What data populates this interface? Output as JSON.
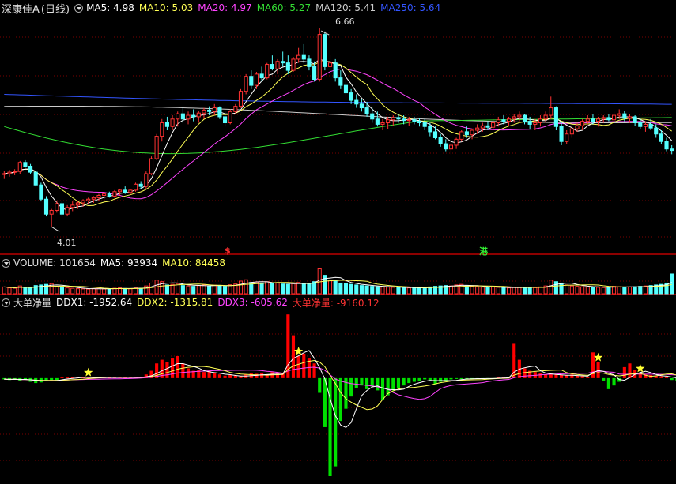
{
  "colors": {
    "up": "#ff3232",
    "down": "#54ffff",
    "ddx_pos": "#ff0000",
    "ddx_neg": "#00e000",
    "ma5": "#ffffff",
    "ma10": "#ffff55",
    "ma20": "#ff44ff",
    "ma60": "#33dd33",
    "ma120": "#cccccc",
    "ma250": "#3355ff",
    "grid": "#7a0000",
    "separator": "#bb0000"
  },
  "price_panel": {
    "title": "深康佳A",
    "period": "(日线)",
    "icon": "chevron-down-icon",
    "mas": [
      {
        "label": "MA5: 4.98",
        "color": "#ffffff"
      },
      {
        "label": "MA10: 5.03",
        "color": "#ffff55"
      },
      {
        "label": "MA20: 4.97",
        "color": "#ff44ff"
      },
      {
        "label": "MA60: 5.27",
        "color": "#33dd33"
      },
      {
        "label": "MA120: 5.41",
        "color": "#cccccc"
      },
      {
        "label": "MA250: 5.64",
        "color": "#3355ff"
      }
    ],
    "high_label": "6.66",
    "low_label": "4.01",
    "marker_s": "$",
    "marker_gang": "港"
  },
  "volume_panel": {
    "title": "VOLUME: 101654",
    "ma5": "MA5: 93934",
    "ma10": "MA10: 84458"
  },
  "ddx_panel": {
    "title": "大单净量",
    "ddx1": "DDX1: -1952.64",
    "ddx2": "DDX2: -1315.81",
    "ddx3": "DDX3: -605.62",
    "net": "大单净量: -9160.12"
  },
  "chart_data": {
    "type": "candlestick",
    "count": 132,
    "y_range_price": [
      3.75,
      6.85
    ],
    "ohlc": [
      [
        4.72,
        4.76,
        4.65,
        4.72
      ],
      [
        4.72,
        4.77,
        4.68,
        4.74
      ],
      [
        4.74,
        4.78,
        4.7,
        4.75
      ],
      [
        4.75,
        4.89,
        4.72,
        4.87
      ],
      [
        4.87,
        4.9,
        4.8,
        4.82
      ],
      [
        4.82,
        4.85,
        4.72,
        4.74
      ],
      [
        4.74,
        4.76,
        4.55,
        4.57
      ],
      [
        4.57,
        4.6,
        4.35,
        4.38
      ],
      [
        4.38,
        4.42,
        4.15,
        4.18
      ],
      [
        4.18,
        4.25,
        4.01,
        4.23
      ],
      [
        4.23,
        4.35,
        4.2,
        4.32
      ],
      [
        4.32,
        4.35,
        4.15,
        4.18
      ],
      [
        4.18,
        4.3,
        4.15,
        4.27
      ],
      [
        4.27,
        4.35,
        4.22,
        4.3
      ],
      [
        4.3,
        4.36,
        4.25,
        4.33
      ],
      [
        4.33,
        4.38,
        4.28,
        4.36
      ],
      [
        4.36,
        4.4,
        4.32,
        4.38
      ],
      [
        4.38,
        4.42,
        4.33,
        4.4
      ],
      [
        4.4,
        4.45,
        4.35,
        4.43
      ],
      [
        4.43,
        4.47,
        4.38,
        4.45
      ],
      [
        4.45,
        4.48,
        4.4,
        4.42
      ],
      [
        4.42,
        4.5,
        4.4,
        4.48
      ],
      [
        4.48,
        4.52,
        4.43,
        4.5
      ],
      [
        4.5,
        4.55,
        4.45,
        4.47
      ],
      [
        4.47,
        4.52,
        4.44,
        4.5
      ],
      [
        4.5,
        4.6,
        4.48,
        4.58
      ],
      [
        4.58,
        4.62,
        4.52,
        4.55
      ],
      [
        4.55,
        4.75,
        4.52,
        4.72
      ],
      [
        4.72,
        4.95,
        4.7,
        4.92
      ],
      [
        4.92,
        5.25,
        4.9,
        5.22
      ],
      [
        5.22,
        5.45,
        5.15,
        5.4
      ],
      [
        5.4,
        5.48,
        5.3,
        5.35
      ],
      [
        5.35,
        5.5,
        5.3,
        5.45
      ],
      [
        5.45,
        5.55,
        5.35,
        5.52
      ],
      [
        5.52,
        5.6,
        5.4,
        5.45
      ],
      [
        5.45,
        5.55,
        5.38,
        5.5
      ],
      [
        5.5,
        5.58,
        5.42,
        5.48
      ],
      [
        5.48,
        5.56,
        5.4,
        5.53
      ],
      [
        5.53,
        5.6,
        5.45,
        5.57
      ],
      [
        5.57,
        5.62,
        5.5,
        5.55
      ],
      [
        5.55,
        5.65,
        5.5,
        5.6
      ],
      [
        5.6,
        5.62,
        5.45,
        5.48
      ],
      [
        5.48,
        5.55,
        5.35,
        5.4
      ],
      [
        5.4,
        5.58,
        5.38,
        5.55
      ],
      [
        5.55,
        5.65,
        5.52,
        5.62
      ],
      [
        5.62,
        5.85,
        5.6,
        5.82
      ],
      [
        5.82,
        6.05,
        5.78,
        6.02
      ],
      [
        6.02,
        6.1,
        5.85,
        5.9
      ],
      [
        5.9,
        6.08,
        5.85,
        6.05
      ],
      [
        6.05,
        6.15,
        5.95,
        6.0
      ],
      [
        6.0,
        6.2,
        5.98,
        6.18
      ],
      [
        6.18,
        6.3,
        6.1,
        6.12
      ],
      [
        6.12,
        6.25,
        6.05,
        6.22
      ],
      [
        6.22,
        6.35,
        6.15,
        6.2
      ],
      [
        6.2,
        6.3,
        6.05,
        6.1
      ],
      [
        6.1,
        6.28,
        6.08,
        6.25
      ],
      [
        6.25,
        6.4,
        6.2,
        6.3
      ],
      [
        6.3,
        6.45,
        6.2,
        6.25
      ],
      [
        6.25,
        6.3,
        6.1,
        6.15
      ],
      [
        6.15,
        6.22,
        5.95,
        5.98
      ],
      [
        5.98,
        6.66,
        5.95,
        6.58
      ],
      [
        6.58,
        6.62,
        6.1,
        6.15
      ],
      [
        6.15,
        6.3,
        6.08,
        6.2
      ],
      [
        6.2,
        6.25,
        5.95,
        6.0
      ],
      [
        6.0,
        6.1,
        5.85,
        5.9
      ],
      [
        5.9,
        5.95,
        5.75,
        5.8
      ],
      [
        5.8,
        5.85,
        5.65,
        5.7
      ],
      [
        5.7,
        5.78,
        5.6,
        5.65
      ],
      [
        5.65,
        5.72,
        5.55,
        5.6
      ],
      [
        5.6,
        5.68,
        5.48,
        5.52
      ],
      [
        5.52,
        5.6,
        5.4,
        5.45
      ],
      [
        5.45,
        5.55,
        5.35,
        5.38
      ],
      [
        5.38,
        5.45,
        5.3,
        5.4
      ],
      [
        5.4,
        5.48,
        5.32,
        5.44
      ],
      [
        5.44,
        5.5,
        5.36,
        5.47
      ],
      [
        5.47,
        5.52,
        5.4,
        5.45
      ],
      [
        5.45,
        5.5,
        5.38,
        5.43
      ],
      [
        5.43,
        5.48,
        5.36,
        5.44
      ],
      [
        5.44,
        5.48,
        5.38,
        5.42
      ],
      [
        5.42,
        5.46,
        5.35,
        5.4
      ],
      [
        5.4,
        5.45,
        5.3,
        5.35
      ],
      [
        5.35,
        5.4,
        5.22,
        5.28
      ],
      [
        5.28,
        5.35,
        5.18,
        5.2
      ],
      [
        5.2,
        5.25,
        5.08,
        5.12
      ],
      [
        5.12,
        5.18,
        5.02,
        5.05
      ],
      [
        5.05,
        5.12,
        4.98,
        5.1
      ],
      [
        5.1,
        5.2,
        5.05,
        5.18
      ],
      [
        5.18,
        5.3,
        5.15,
        5.28
      ],
      [
        5.28,
        5.35,
        5.2,
        5.24
      ],
      [
        5.24,
        5.32,
        5.18,
        5.3
      ],
      [
        5.3,
        5.38,
        5.25,
        5.33
      ],
      [
        5.33,
        5.4,
        5.28,
        5.36
      ],
      [
        5.36,
        5.42,
        5.3,
        5.34
      ],
      [
        5.34,
        5.45,
        5.3,
        5.4
      ],
      [
        5.4,
        5.48,
        5.35,
        5.44
      ],
      [
        5.44,
        5.5,
        5.38,
        5.42
      ],
      [
        5.42,
        5.48,
        5.36,
        5.45
      ],
      [
        5.45,
        5.52,
        5.4,
        5.48
      ],
      [
        5.48,
        5.55,
        5.42,
        5.5
      ],
      [
        5.5,
        5.52,
        5.38,
        5.42
      ],
      [
        5.42,
        5.48,
        5.32,
        5.38
      ],
      [
        5.38,
        5.45,
        5.3,
        5.4
      ],
      [
        5.4,
        5.5,
        5.35,
        5.45
      ],
      [
        5.45,
        5.55,
        5.4,
        5.5
      ],
      [
        5.5,
        5.75,
        5.45,
        5.6
      ],
      [
        5.6,
        5.62,
        5.3,
        5.35
      ],
      [
        5.35,
        5.42,
        5.1,
        5.15
      ],
      [
        5.15,
        5.3,
        5.12,
        5.25
      ],
      [
        5.25,
        5.35,
        5.2,
        5.32
      ],
      [
        5.32,
        5.4,
        5.28,
        5.36
      ],
      [
        5.36,
        5.45,
        5.3,
        5.42
      ],
      [
        5.42,
        5.5,
        5.38,
        5.45
      ],
      [
        5.45,
        5.52,
        5.38,
        5.42
      ],
      [
        5.42,
        5.48,
        5.35,
        5.45
      ],
      [
        5.45,
        5.5,
        5.4,
        5.47
      ],
      [
        5.47,
        5.52,
        5.42,
        5.44
      ],
      [
        5.44,
        5.55,
        5.4,
        5.5
      ],
      [
        5.5,
        5.58,
        5.45,
        5.52
      ],
      [
        5.52,
        5.56,
        5.42,
        5.46
      ],
      [
        5.46,
        5.52,
        5.4,
        5.48
      ],
      [
        5.48,
        5.5,
        5.36,
        5.4
      ],
      [
        5.4,
        5.46,
        5.32,
        5.35
      ],
      [
        5.35,
        5.42,
        5.28,
        5.38
      ],
      [
        5.38,
        5.45,
        5.3,
        5.33
      ],
      [
        5.33,
        5.38,
        5.2,
        5.25
      ],
      [
        5.25,
        5.3,
        5.12,
        5.15
      ],
      [
        5.15,
        5.2,
        5.02,
        5.05
      ],
      [
        5.05,
        5.1,
        4.98,
        5.03
      ]
    ],
    "volume_range": [
      0,
      130000
    ],
    "volume": [
      35000,
      30000,
      28000,
      40000,
      32000,
      30000,
      42000,
      45000,
      48000,
      52000,
      38000,
      35000,
      30000,
      28000,
      26000,
      25000,
      24000,
      26000,
      27000,
      25000,
      24000,
      28000,
      30000,
      27000,
      26000,
      30000,
      28000,
      40000,
      55000,
      70000,
      62000,
      45000,
      48000,
      52000,
      42000,
      40000,
      38000,
      42000,
      45000,
      40000,
      44000,
      42000,
      38000,
      46000,
      50000,
      65000,
      72000,
      58000,
      60000,
      55000,
      62000,
      52000,
      55000,
      50000,
      48000,
      52000,
      58000,
      54000,
      50000,
      62000,
      128000,
      95000,
      70000,
      65000,
      55000,
      52000,
      48000,
      45000,
      42000,
      40000,
      38000,
      36000,
      35000,
      34000,
      33000,
      32000,
      31000,
      30000,
      30000,
      29000,
      32000,
      35000,
      38000,
      40000,
      42000,
      40000,
      45000,
      48000,
      40000,
      38000,
      36000,
      34000,
      32000,
      35000,
      33000,
      31000,
      30000,
      32000,
      33000,
      34000,
      32000,
      31000,
      35000,
      40000,
      70000,
      62000,
      55000,
      45000,
      40000,
      38000,
      36000,
      35000,
      34000,
      33000,
      32000,
      34000,
      38000,
      36000,
      34000,
      35000,
      36000,
      38000,
      40000,
      42000,
      45000,
      48000,
      55000,
      101654
    ],
    "ddx_range": [
      -8000,
      5600
    ],
    "ddx": [
      -100,
      -150,
      -80,
      -200,
      -120,
      -300,
      -400,
      -350,
      -250,
      -150,
      -200,
      100,
      80,
      60,
      90,
      50,
      70,
      40,
      60,
      80,
      50,
      70,
      90,
      60,
      80,
      100,
      120,
      300,
      600,
      1200,
      1500,
      1300,
      1600,
      1800,
      1200,
      800,
      600,
      700,
      500,
      600,
      400,
      300,
      200,
      250,
      200,
      150,
      300,
      400,
      350,
      450,
      300,
      500,
      400,
      450,
      5200,
      3500,
      1800,
      2000,
      1600,
      1200,
      -1200,
      -4000,
      -8000,
      -7200,
      -3500,
      -2500,
      -1500,
      -800,
      -600,
      -900,
      -700,
      -1000,
      -1800,
      -1400,
      -1000,
      -800,
      -600,
      -400,
      -300,
      -200,
      -100,
      -150,
      -500,
      -300,
      -200,
      -100,
      -50,
      -80,
      -40,
      -60,
      -30,
      -20,
      -50,
      -40,
      80,
      100,
      120,
      2800,
      1500,
      800,
      600,
      500,
      400,
      300,
      350,
      300,
      280,
      250,
      300,
      200,
      150,
      100,
      2100,
      1300,
      -200,
      -900,
      -600,
      -300,
      900,
      1200,
      700,
      400,
      300,
      250,
      200,
      150,
      100,
      -150,
      -200,
      -300,
      -250,
      -200
    ],
    "stars_at": [
      16,
      56,
      113,
      121
    ],
    "note_low_index": 9,
    "note_high_index": 60,
    "marker_s_index": 46,
    "marker_gang_index": 98
  }
}
